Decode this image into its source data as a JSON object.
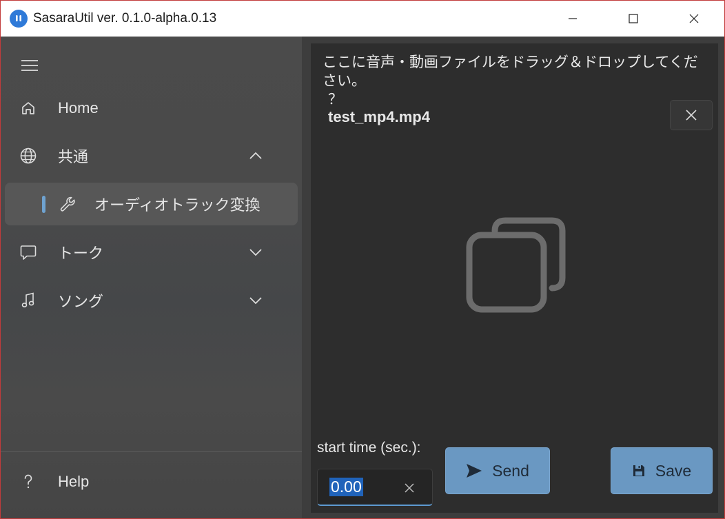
{
  "window": {
    "title": "SasaraUtil ver. 0.1.0-alpha.0.13"
  },
  "sidebar": {
    "items": [
      {
        "label": "Home",
        "icon": "home-icon"
      },
      {
        "label": "共通",
        "icon": "globe-icon",
        "expanded": true
      },
      {
        "label": "オーディオトラック変換",
        "icon": "wrench-icon",
        "selected": true
      },
      {
        "label": "トーク",
        "icon": "chat-icon",
        "expanded": false
      },
      {
        "label": "ソング",
        "icon": "music-note-icon",
        "expanded": false
      }
    ],
    "footer": {
      "label": "Help",
      "icon": "question-icon"
    }
  },
  "content": {
    "instruction": "ここに音声・動画ファイルをドラッグ＆ドロップしてください。",
    "instruction_mark": "？",
    "filename": "test_mp4.mp4",
    "start_time_label": "start time (sec.):",
    "start_time_value": "0.00",
    "send_label": "Send",
    "save_label": "Save"
  },
  "colors": {
    "accent": "#6a98c2",
    "selection_bar": "#6fa3d1",
    "window_border": "#c23b3b"
  }
}
